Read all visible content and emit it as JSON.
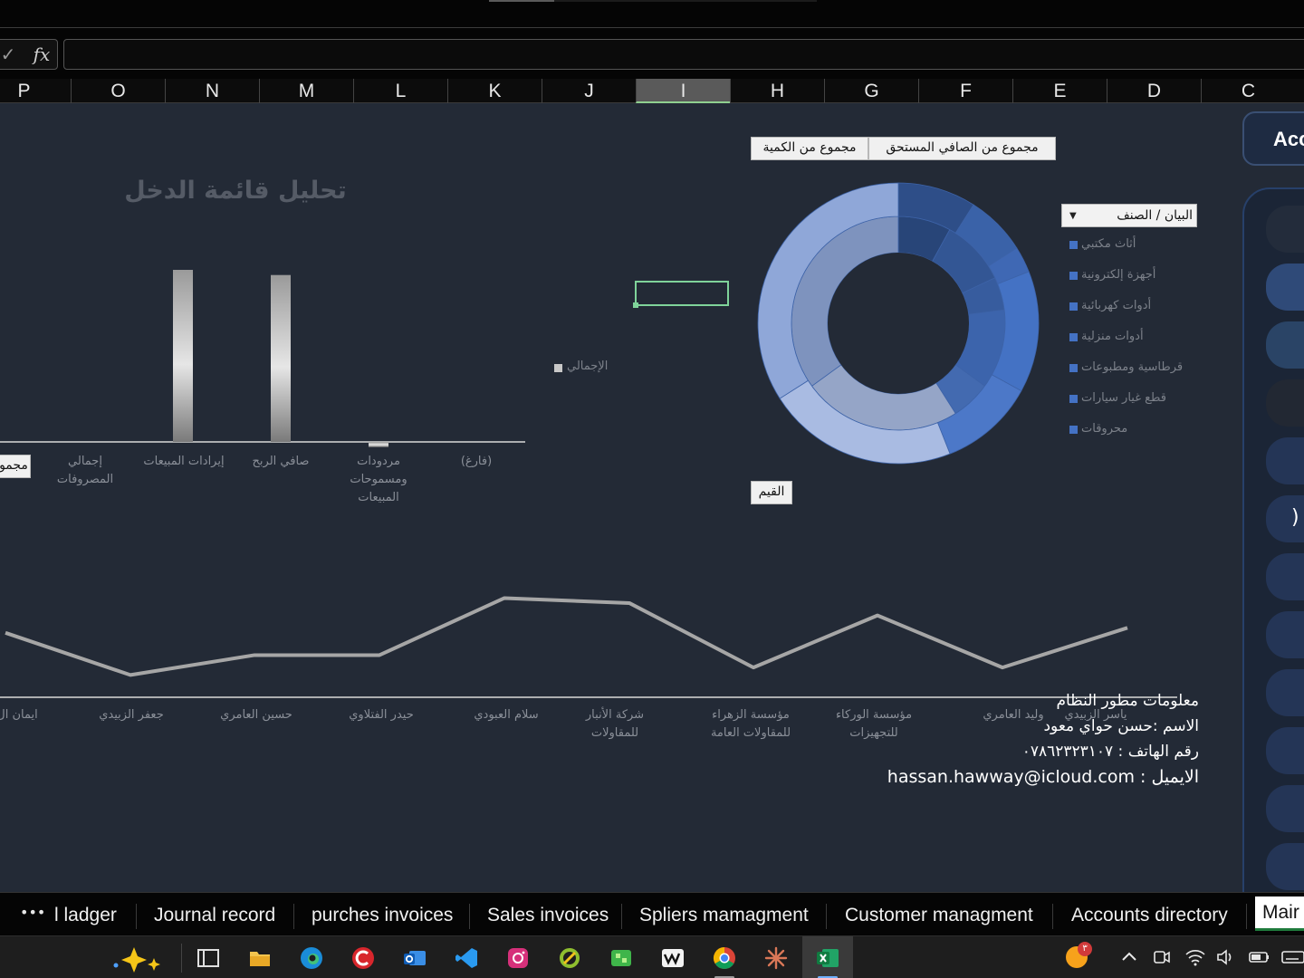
{
  "formula_bar": {
    "fx_label": "fx",
    "check_icon": "✓",
    "value": ""
  },
  "columns": [
    "P",
    "O",
    "N",
    "M",
    "L",
    "K",
    "J",
    "I",
    "H",
    "G",
    "F",
    "E",
    "D",
    "C"
  ],
  "active_column": "I",
  "income_chart": {
    "title": "تحليل قائمة الدخل",
    "field_button": "مجمو",
    "series_legend": "الإجمالي",
    "categories": [
      "إجمالي المصروفات",
      "إيرادات المبيعات",
      "صافي الربح",
      "مردودات ومسموحات المبيعات",
      "(فارغ)"
    ]
  },
  "donut_chart": {
    "value_button_quantity": "مجموع من الكمية",
    "value_button_net": "مجموع من الصافي المستحق",
    "values_button": "القيم",
    "slicer_title": "البيان / الصنف",
    "legend": [
      "أثاث مكتبي",
      "أجهزة إلكترونية",
      "أدوات كهربائية",
      "أدوات منزلية",
      "قرطاسية ومطبوعات",
      "قطع غيار سيارات",
      "محروقات"
    ]
  },
  "line_chart": {
    "categories": [
      "ياسر الزبيدي",
      "وليد العامري",
      "مؤسسة الوركاء للتجهيزات",
      "مؤسسة الزهراء للمقاولات العامة",
      "شركة الأنبار للمقاولات",
      "سلام العبودي",
      "حيدر الفتلاوي",
      "حسين العامري",
      "جعفر الزبيدي",
      "ايمان ال"
    ]
  },
  "chart_data": [
    {
      "type": "bar",
      "title": "تحليل قائمة الدخل",
      "categories": [
        "(فارغ)",
        "مردودات ومسموحات المبيعات",
        "صافي الربح",
        "إيرادات المبيعات",
        "إجمالي المصروفات"
      ],
      "series": [
        {
          "name": "الإجمالي",
          "values": [
            0,
            -3,
            97,
            100,
            0
          ]
        }
      ],
      "ylim": [
        -5,
        100
      ]
    },
    {
      "type": "pie",
      "subtype": "donut-two-ring",
      "categories": [
        "أثاث مكتبي",
        "أجهزة إلكترونية",
        "أدوات كهربائية",
        "أدوات منزلية",
        "قرطاسية ومطبوعات",
        "قطع غيار سيارات",
        "محروقات"
      ],
      "series": [
        {
          "name": "مجموع من الكمية",
          "values": [
            8,
            10,
            5,
            12,
            6,
            24,
            35
          ]
        },
        {
          "name": "مجموع من الصافي المستحق",
          "values": [
            9,
            7,
            3,
            14,
            11,
            22,
            34
          ]
        }
      ]
    },
    {
      "type": "line",
      "categories": [
        "ياسر الزبيدي",
        "وليد العامري",
        "مؤسسة الوركاء للتجهيزات",
        "مؤسسة الزهراء للمقاولات العامة",
        "شركة الأنبار للمقاولات",
        "سلام العبودي",
        "حيدر الفتلاوي",
        "حسين العامري",
        "جعفر الزبيدي",
        "ايمان ال"
      ],
      "series": [
        {
          "name": "",
          "values": [
            28,
            12,
            33,
            12,
            38,
            40,
            17,
            17,
            9,
            26
          ]
        }
      ]
    }
  ],
  "developer_info": {
    "heading": "معلومات مطور النظام",
    "name_line": "الاسم :حسن حواي معود",
    "phone_line": "رقم الهاتف : ٠٧٨٦٢٣٢٣١٠٧",
    "email_line": "الايميل : hassan.hawway@icloud.com"
  },
  "sidebar": {
    "title_fragment": "Acc",
    "paren_fragment": ")"
  },
  "sheet_tabs": [
    "l ladger",
    "Journal record",
    "purches invoices",
    "Sales invoices",
    "Spliers mamagment",
    "Customer managment",
    "Accounts directory",
    "Mair"
  ],
  "tab_more": "•••",
  "taskbar": {
    "notification_count": "٣"
  },
  "colors": {
    "sheet_bg": "#232a36",
    "donut_base": "#4472c4",
    "bar_gradient": "#c8c8c8",
    "text_muted": "#8a8f98"
  }
}
